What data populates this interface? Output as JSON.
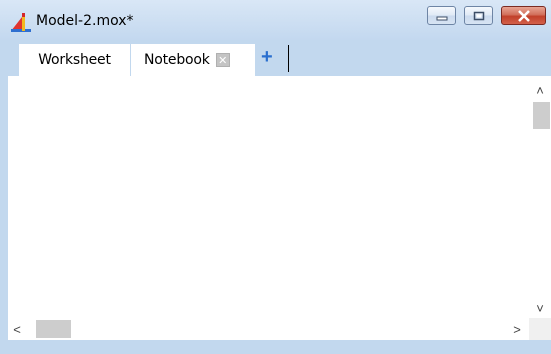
{
  "window": {
    "title": "Model-2.mox*",
    "icon": "app-logo-icon",
    "controls": {
      "minimize_icon": "minimize-icon",
      "maximize_icon": "maximize-icon",
      "close_icon": "close-icon"
    }
  },
  "tabs": [
    {
      "label": "Worksheet",
      "active": true
    },
    {
      "label": "Notebook",
      "active": false,
      "close_glyph": "✕"
    }
  ],
  "add_tab_glyph": "+",
  "scrollbars": {
    "up_glyph": "˄",
    "down_glyph": "˅",
    "left_glyph": "<",
    "right_glyph": ">"
  },
  "colors": {
    "frame": "#c2d8ee",
    "add_tab": "#2a6fcf",
    "close_button": "#c1402a"
  }
}
